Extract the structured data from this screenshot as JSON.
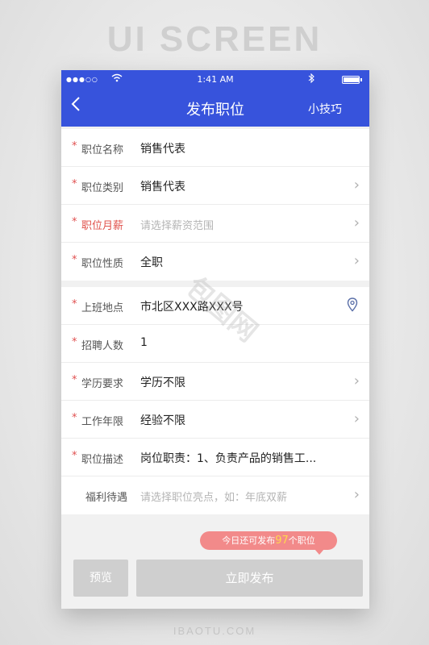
{
  "background": {
    "title": "UI SCREEN",
    "footer": "IBAOTU.COM",
    "watermark": "包图网"
  },
  "colors": {
    "header": "#3753dc",
    "required": "#e05050",
    "bubble": "#f28a8a",
    "button": "#cfcfcf"
  },
  "status_bar": {
    "time": "1:41 AM",
    "signal": "●●●○○",
    "battery_level": 0.95
  },
  "header": {
    "back_icon": "chevron-left-icon",
    "title": "发布职位",
    "tips_label": "小技巧"
  },
  "form": {
    "job_name": {
      "label": "职位名称",
      "value": "销售代表",
      "required": true
    },
    "job_category": {
      "label": "职位类别",
      "value": "销售代表",
      "required": true
    },
    "monthly_salary": {
      "label": "职位月薪",
      "placeholder": "请选择薪资范围",
      "required": true
    },
    "job_nature": {
      "label": "职位性质",
      "value": "全职",
      "required": true
    },
    "work_location": {
      "label": "上班地点",
      "value": "市北区XXX路XXX号",
      "required": true,
      "icon": "location-pin-icon"
    },
    "headcount": {
      "label": "招聘人数",
      "value": "1",
      "required": true
    },
    "education": {
      "label": "学历要求",
      "value": "学历不限",
      "required": true
    },
    "experience": {
      "label": "工作年限",
      "value": "经验不限",
      "required": true
    },
    "description": {
      "label": "职位描述",
      "value": "岗位职责：1、负责产品的销售工...",
      "required": true
    },
    "benefits": {
      "label": "福利待遇",
      "placeholder": "请选择职位亮点，如：年底双薪",
      "required": false
    }
  },
  "quota": {
    "prefix": "今日还可发布",
    "count": "97",
    "suffix": "个职位"
  },
  "buttons": {
    "preview": "预览",
    "publish": "立即发布"
  }
}
